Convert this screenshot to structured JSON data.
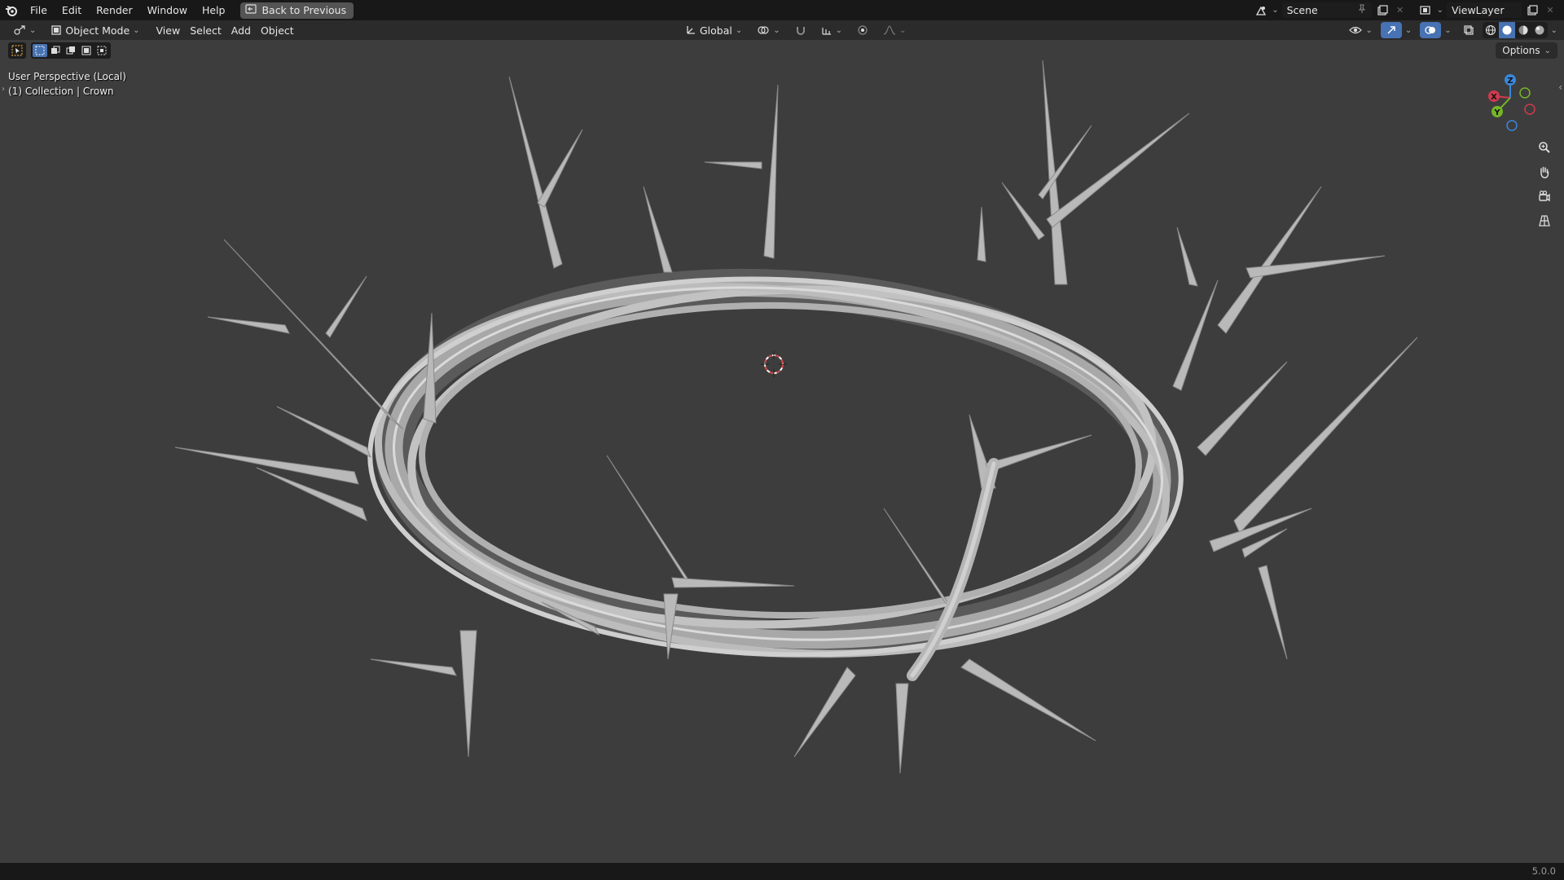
{
  "topbar": {
    "menu": [
      "File",
      "Edit",
      "Render",
      "Window",
      "Help"
    ],
    "back_label": "Back to Previous",
    "scene": "Scene",
    "view_layer": "ViewLayer"
  },
  "header": {
    "mode": "Object Mode",
    "menus": [
      "View",
      "Select",
      "Add",
      "Object"
    ],
    "orientation": "Global",
    "options": "Options"
  },
  "viewport": {
    "perspective": "User Perspective (Local)",
    "collection": "(1) Collection | Crown"
  },
  "gizmo": {
    "x": "X",
    "y": "Y",
    "z": "Z"
  },
  "status": {
    "version": "5.0.0"
  },
  "colors": {
    "accent": "#4772b3",
    "axis_x": "#d2394f",
    "axis_y": "#76b52a",
    "axis_z": "#3a87d9",
    "background": "#3d3d3d"
  }
}
